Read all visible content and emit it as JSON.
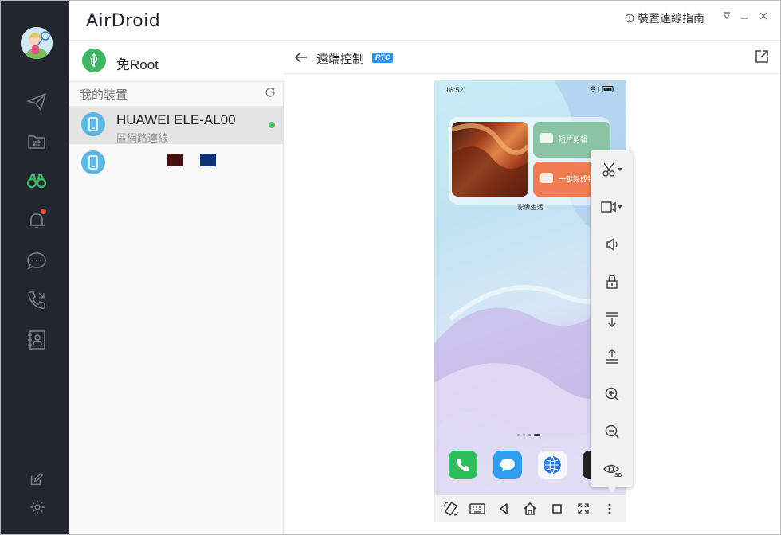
{
  "app": {
    "brand": "AirDroid",
    "guide_link": "裝置連線指南",
    "guide_icon": "info-circle-icon",
    "window_controls": [
      "collapse-icon",
      "minimize-icon",
      "close-icon"
    ]
  },
  "rail": {
    "items": [
      {
        "icon": "send-icon"
      },
      {
        "icon": "file-transfer-icon"
      },
      {
        "icon": "binoculars-icon",
        "active": true,
        "color": "#3fb662"
      },
      {
        "icon": "bell-icon",
        "badge": true
      },
      {
        "icon": "chat-bubble-icon"
      },
      {
        "icon": "phone-call-icon"
      },
      {
        "icon": "contacts-icon"
      }
    ],
    "bottom": [
      {
        "icon": "edit-icon"
      },
      {
        "icon": "settings-icon"
      }
    ]
  },
  "device_panel": {
    "root_label": "免Root",
    "section_label": "我的裝置",
    "devices": [
      {
        "name": "HUAWEI ELE-AL00",
        "status": "區網路連線",
        "online": true,
        "selected": true
      },
      {
        "name": "",
        "status": "",
        "online": false,
        "selected": false
      }
    ]
  },
  "remote": {
    "title": "遠端控制",
    "badge": "RTC"
  },
  "phone": {
    "status_time": "16:52",
    "widget_tile_1": "短片剪輯",
    "widget_tile_2": "一鍵製成特",
    "widget_caption": "影像生活",
    "dock": [
      "phone-app-icon",
      "messages-app-icon",
      "browser-app-icon"
    ]
  },
  "control_bar": [
    "rotate-icon",
    "keyboard-icon",
    "back-triangle-icon",
    "home-icon",
    "recents-square-icon",
    "fullscreen-icon",
    "more-vertical-icon"
  ],
  "toolbox": [
    "screenshot-scissors-icon",
    "record-video-icon",
    "volume-icon",
    "lock-screen-icon",
    "notification-down-icon",
    "notification-up-icon",
    "zoom-in-icon",
    "zoom-out-icon",
    "eye-sd-icon"
  ],
  "colors": {
    "rail_bg": "#22262e",
    "accent_green": "#3fb662",
    "device_blue": "#5db8e4",
    "rtc_badge": "#2f8ff0"
  }
}
